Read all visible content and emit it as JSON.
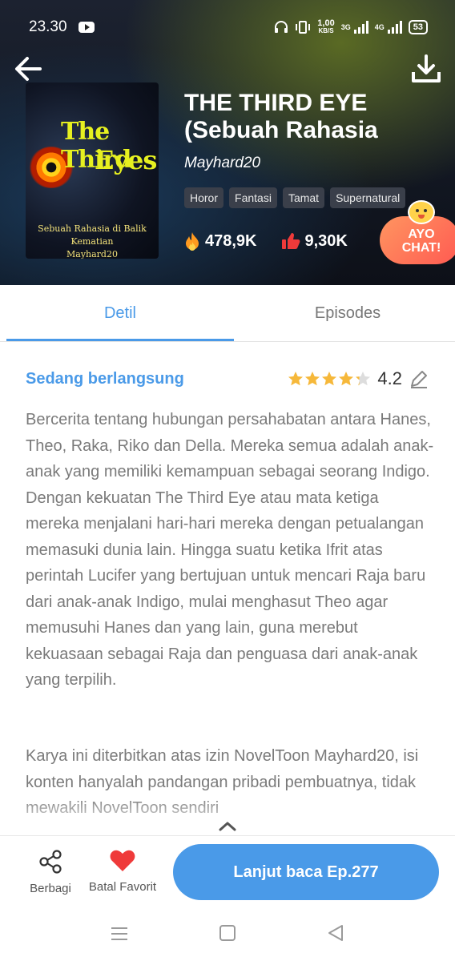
{
  "status_bar": {
    "time": "23.30",
    "speed_value": "1,00",
    "speed_unit": "KB/S",
    "net1": "3G",
    "net2": "4G",
    "battery": "53"
  },
  "cover": {
    "title_line1": "The Third",
    "title_line2": "Eyes",
    "subtitle_line1": "Sebuah Rahasia di Balik",
    "subtitle_line2": "Kematian",
    "subtitle_line3": "Mayhard20"
  },
  "book": {
    "title": "THE THIRD EYE (Sebuah Rahasia",
    "author": "Mayhard20",
    "tags": [
      "Horor",
      "Fantasi",
      "Tamat",
      "Supernatural"
    ],
    "views": "478,9K",
    "likes": "9,30K"
  },
  "chat_badge": {
    "line1": "AYO",
    "line2": "CHAT!"
  },
  "tabs": [
    {
      "label": "Detil",
      "active": true
    },
    {
      "label": "Episodes",
      "active": false
    }
  ],
  "detail": {
    "status": "Sedang berlangsung",
    "rating": "4.2",
    "rating_value": 4.2,
    "description": "Bercerita tentang hubungan persahabatan antara Hanes, Theo, Raka, Riko dan Della. Mereka semua adalah anak-anak yang memiliki kemampuan sebagai seorang Indigo. Dengan kekuatan The Third Eye atau mata ketiga mereka menjalani hari-hari mereka dengan petualangan memasuki dunia lain. Hingga suatu ketika Ifrit atas perintah Lucifer yang bertujuan untuk mencari Raja baru dari anak-anak Indigo, mulai menghasut Theo agar memusuhi Hanes dan yang lain, guna merebut kekuasaan sebagai Raja dan penguasa dari anak-anak yang terpilih.",
    "note": "Karya ini diterbitkan atas izin NovelToon Mayhard20, isi konten hanyalah pandangan pribadi pembuatnya, tidak mewakili NovelToon sendiri"
  },
  "bottom_bar": {
    "share_label": "Berbagi",
    "favorite_label": "Batal Favorit",
    "continue_label": "Lanjut baca Ep.277"
  },
  "colors": {
    "accent": "#4a9ae8",
    "favorite": "#ef3a3a",
    "fire": "#ff9a1f",
    "star": "#f6b83a",
    "chat_badge": "#ff6b55"
  }
}
